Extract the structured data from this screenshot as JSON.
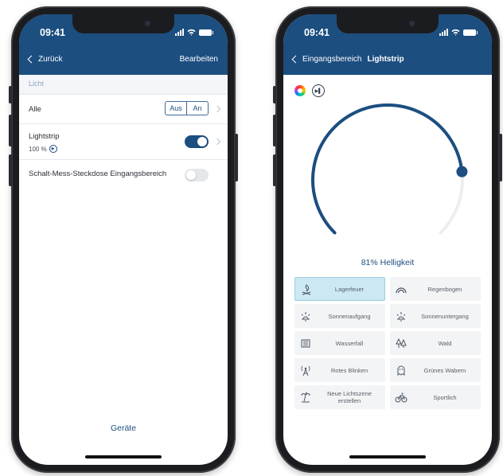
{
  "status": {
    "time": "09:41"
  },
  "left": {
    "nav": {
      "back_label": "Zurück",
      "edit_label": "Bearbeiten"
    },
    "section_header": "Licht",
    "rows": [
      {
        "label": "Alle",
        "seg_off": "Aus",
        "seg_on": "An"
      },
      {
        "label": "Lightstrip",
        "sub": "100 %",
        "toggle_on": true
      },
      {
        "label": "Schalt-Mess-Steckdose Eingangsbereich",
        "toggle_on": false
      }
    ],
    "bottom_tab": "Geräte"
  },
  "right": {
    "nav": {
      "back_label": "Eingangsbereich",
      "title": "Lightstrip"
    },
    "brightness": {
      "value_percent": 81,
      "label": "81% Helligkeit"
    },
    "accent": "#1c4e80",
    "scenes": [
      {
        "label": "Lagerfeuer",
        "icon": "campfire-icon",
        "active": true
      },
      {
        "label": "Regenbogen",
        "icon": "rainbow-icon",
        "active": false
      },
      {
        "label": "Sonnenaufgang",
        "icon": "sunrise-icon",
        "active": false
      },
      {
        "label": "Sonnenuntergang",
        "icon": "sunset-icon",
        "active": false
      },
      {
        "label": "Wasserfall",
        "icon": "waterfall-icon",
        "active": false
      },
      {
        "label": "Wald",
        "icon": "forest-icon",
        "active": false
      },
      {
        "label": "Rotes Blinken",
        "icon": "blinking-antenna-icon",
        "active": false
      },
      {
        "label": "Grünes Wabern",
        "icon": "ghost-icon",
        "active": false
      },
      {
        "label": "Neue Lichtszene erstellen",
        "icon": "palm-island-icon",
        "active": false
      },
      {
        "label": "Sportlich",
        "icon": "bicycle-icon",
        "active": false
      }
    ]
  }
}
